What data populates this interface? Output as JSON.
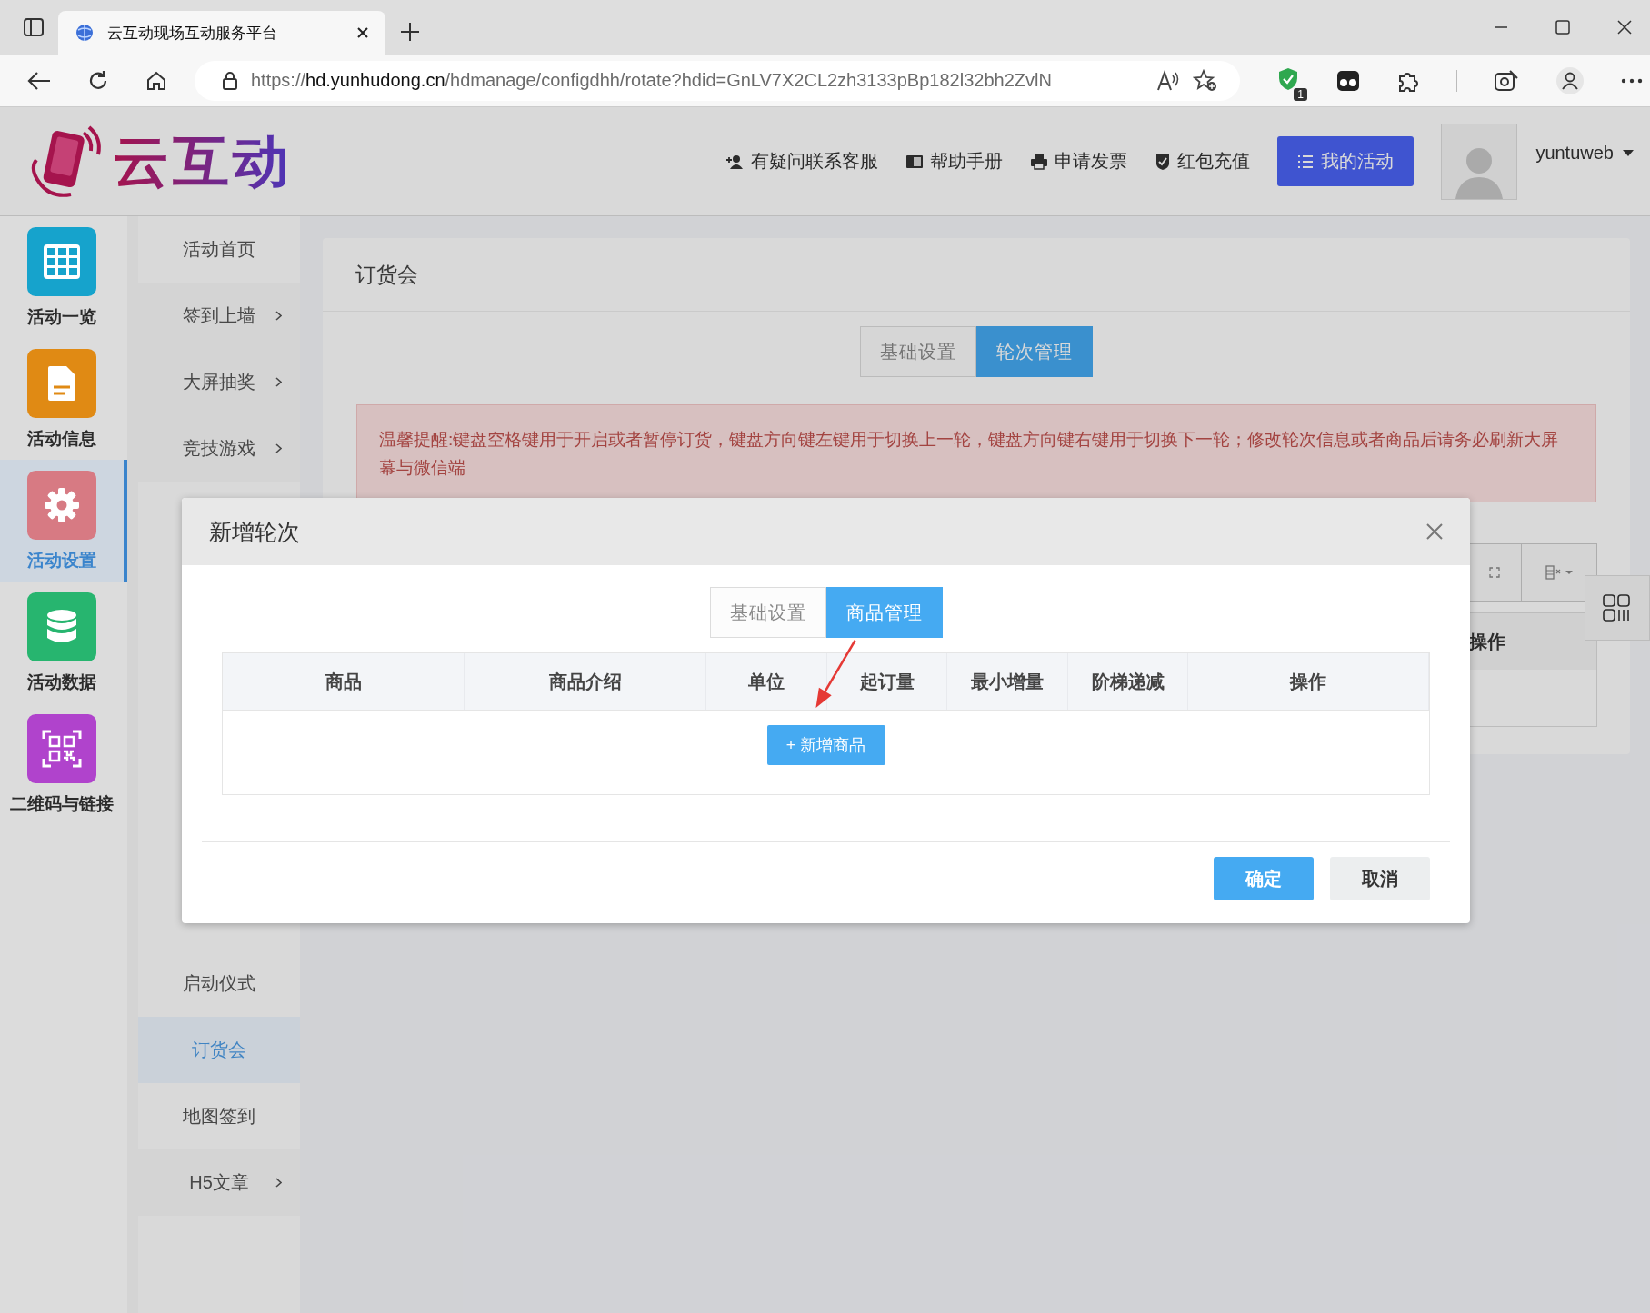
{
  "browser": {
    "tab_title": "云互动现场互动服务平台",
    "url_scheme": "https://",
    "url_host": "hd.yunhudong.cn",
    "url_path": "/hdmanage/configdhh/rotate?hdid=GnLV7X2CL2zh3133pBp182l32bh2ZvlN",
    "extension_badge": "1"
  },
  "header": {
    "logo_text": "云互动",
    "nav": [
      {
        "label": "有疑问联系客服",
        "kind": "user-plus"
      },
      {
        "label": "帮助手册",
        "kind": "book"
      },
      {
        "label": "申请发票",
        "kind": "printer"
      },
      {
        "label": "红包充值",
        "kind": "shield"
      }
    ],
    "primary_button": "我的活动",
    "username": "yuntuweb"
  },
  "sidebar": {
    "items": [
      {
        "label": "活动一览",
        "kind": "grid",
        "color": "#16a3cc",
        "selected": false
      },
      {
        "label": "活动信息",
        "kind": "document",
        "color": "#e08a14",
        "selected": false
      },
      {
        "label": "活动设置",
        "kind": "gear",
        "color": "#d77a83",
        "selected": true
      },
      {
        "label": "活动数据",
        "kind": "database",
        "color": "#27b56f",
        "selected": false
      },
      {
        "label": "二维码与链接",
        "kind": "qrcode",
        "color": "#b043cc",
        "selected": false
      }
    ]
  },
  "submenu": {
    "top_items": [
      {
        "label": "活动首页",
        "expandable": false,
        "selected": false
      },
      {
        "label": "签到上墙",
        "expandable": true,
        "selected": false
      },
      {
        "label": "大屏抽奖",
        "expandable": true,
        "selected": false
      },
      {
        "label": "竞技游戏",
        "expandable": true,
        "selected": false
      }
    ],
    "bottom_items": [
      {
        "label": "启动仪式",
        "expandable": false,
        "selected": false
      },
      {
        "label": "订货会",
        "expandable": false,
        "selected": true
      },
      {
        "label": "地图签到",
        "expandable": false,
        "selected": false
      },
      {
        "label": "H5文章",
        "expandable": true,
        "selected": false
      }
    ]
  },
  "panel": {
    "title": "订货会",
    "tabs": [
      {
        "label": "基础设置",
        "selected": false
      },
      {
        "label": "轮次管理",
        "selected": true
      }
    ],
    "notice": "温馨提醒:键盘空格键用于开启或者暂停订货，键盘方向键左键用于切换上一轮，键盘方向键右键用于切换下一轮；修改轮次信息或者商品后请务必刷新大屏幕与微信端",
    "table_columns": [
      "操作"
    ]
  },
  "dialog": {
    "title": "新增轮次",
    "tabs": [
      {
        "label": "基础设置",
        "selected": false
      },
      {
        "label": "商品管理",
        "selected": true
      }
    ],
    "columns": [
      "商品",
      "商品介绍",
      "单位",
      "起订量",
      "最小增量",
      "阶梯递减",
      "操作"
    ],
    "add_button": "+ 新增商品",
    "buttons": [
      {
        "label": "确定",
        "kind": "primary"
      },
      {
        "label": "取消",
        "kind": "default"
      }
    ]
  }
}
